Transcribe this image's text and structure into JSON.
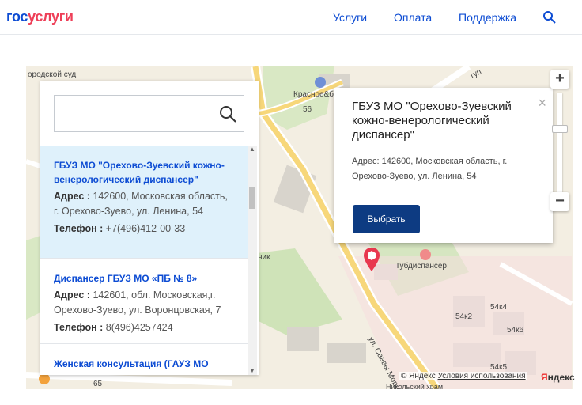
{
  "header": {
    "logo_part1": "гос",
    "logo_part2": "услуги",
    "nav": [
      "Услуги",
      "Оплата",
      "Поддержка"
    ],
    "search_icon": "search-icon"
  },
  "map": {
    "labels": {
      "court": "ородской суд",
      "shop": "Красное&бе",
      "house56": "56",
      "street": "ул. Саввы Мороз",
      "tub": "Тубдиспансер",
      "b54k2": "54к2",
      "b54k4": "54к4",
      "b54k6": "54к6",
      "b54k5": "54к5",
      "b65": "65",
      "nik": "ник",
      "street_gl": "гуп",
      "nikol": "Никольский храм"
    },
    "copyright_text": "© Яндекс",
    "terms_link": "Условия использования",
    "yandex_logo_y": "Я",
    "yandex_logo_rest": "ндекс"
  },
  "list": {
    "search_value": "",
    "items": [
      {
        "title": "ГБУЗ МО \"Орехово-Зуевский кожно-венерологический диспансер\"",
        "address_label": "Адрес :",
        "address": " 142600, Московская область, г. Орехово-Зуево, ул. Ленина, 54",
        "phone_label": "Телефон :",
        "phone": " +7(496)412-00-33"
      },
      {
        "title": "Диспансер ГБУЗ МО «ПБ № 8»",
        "address_label": "Адрес :",
        "address": " 142601, обл. Московская,г. Орехово-Зуево, ул. Воронцовская, 7",
        "phone_label": "Телефон :",
        "phone": " 8(496)4257424"
      },
      {
        "title": "Женская консультация (ГАУЗ МО"
      }
    ]
  },
  "balloon": {
    "title": "ГБУЗ МО \"Орехово-Зуевский кожно-венерологический диспансер\"",
    "address": "Адрес: 142600, Московская область, г. Орехово-Зуево, ул. Ленина, 54",
    "button": "Выбрать",
    "close": "×"
  },
  "zoom": {
    "plus": "+",
    "minus": "−"
  },
  "colors": {
    "brand_blue": "#0d4cd3",
    "brand_red": "#ee3f58",
    "button_dark": "#0d3b82",
    "active_item": "#dff1fb",
    "pin": "#e8384f"
  }
}
